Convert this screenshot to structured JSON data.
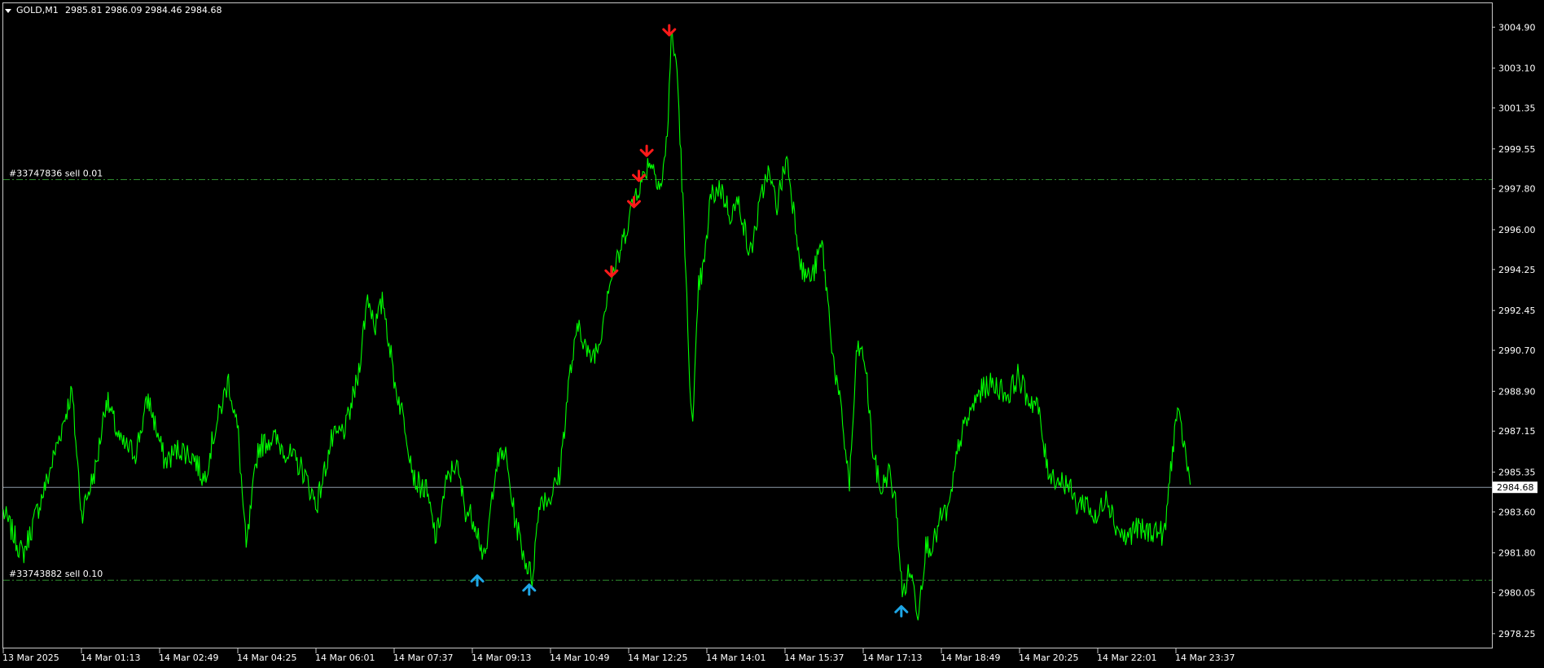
{
  "chart_header": {
    "symbol": "GOLD,M1",
    "ohlc": "2985.81 2986.09 2984.46 2984.68"
  },
  "colors": {
    "background": "#000000",
    "frame": "#c8c8c8",
    "price_line": "#00ff00",
    "current_price_line": "#8c9aa8",
    "order_line": "#2e8b2e",
    "sell_arrow": "#ff1a1a",
    "buy_arrow": "#1ea6e6",
    "text": "#ffffff"
  },
  "chart_data": {
    "type": "line",
    "symbol": "GOLD",
    "timeframe": "M1",
    "x_ticks": [
      "13 Mar 2025",
      "14 Mar 01:13",
      "14 Mar 02:49",
      "14 Mar 04:25",
      "14 Mar 06:01",
      "14 Mar 07:37",
      "14 Mar 09:13",
      "14 Mar 10:49",
      "14 Mar 12:25",
      "14 Mar 14:01",
      "14 Mar 15:37",
      "14 Mar 17:13",
      "14 Mar 18:49",
      "14 Mar 20:25",
      "14 Mar 22:01",
      "14 Mar 23:37"
    ],
    "y_ticks": [
      "3004.90",
      "3003.10",
      "3001.35",
      "2999.55",
      "2997.80",
      "2996.00",
      "2994.25",
      "2992.45",
      "2990.70",
      "2988.90",
      "2987.15",
      "2985.35",
      "2983.60",
      "2981.80",
      "2980.05",
      "2978.25"
    ],
    "ylim": [
      2977.6,
      3005.95
    ],
    "x_index_range": [
      0,
      1520
    ],
    "current_price": "2984.68",
    "series": [
      {
        "points": [
          [
            0,
            2983.6
          ],
          [
            20,
            2981.7
          ],
          [
            45,
            2985.0
          ],
          [
            70,
            2988.9
          ],
          [
            80,
            2983.5
          ],
          [
            95,
            2985.6
          ],
          [
            105,
            2988.6
          ],
          [
            120,
            2986.6
          ],
          [
            135,
            2986.2
          ],
          [
            148,
            2988.6
          ],
          [
            165,
            2985.8
          ],
          [
            180,
            2986.4
          ],
          [
            195,
            2986.0
          ],
          [
            205,
            2985.0
          ],
          [
            215,
            2987.0
          ],
          [
            230,
            2989.4
          ],
          [
            240,
            2987.0
          ],
          [
            248,
            2981.9
          ],
          [
            260,
            2986.4
          ],
          [
            275,
            2986.9
          ],
          [
            290,
            2986.2
          ],
          [
            305,
            2985.5
          ],
          [
            320,
            2983.9
          ],
          [
            335,
            2986.7
          ],
          [
            350,
            2987.3
          ],
          [
            362,
            2989.5
          ],
          [
            372,
            2993.1
          ],
          [
            380,
            2991.8
          ],
          [
            388,
            2992.9
          ],
          [
            400,
            2989.2
          ],
          [
            410,
            2987.5
          ],
          [
            420,
            2985.0
          ],
          [
            432,
            2984.5
          ],
          [
            442,
            2982.4
          ],
          [
            452,
            2984.8
          ],
          [
            462,
            2985.8
          ],
          [
            472,
            2983.7
          ],
          [
            482,
            2983.2
          ],
          [
            492,
            2981.3
          ],
          [
            502,
            2985.5
          ],
          [
            512,
            2986.3
          ],
          [
            522,
            2983.4
          ],
          [
            532,
            2981.6
          ],
          [
            540,
            2980.7
          ],
          [
            548,
            2984.2
          ],
          [
            558,
            2984.2
          ],
          [
            568,
            2985.2
          ],
          [
            578,
            2989.5
          ],
          [
            588,
            2991.9
          ],
          [
            598,
            2990.3
          ],
          [
            608,
            2990.9
          ],
          [
            618,
            2993.6
          ],
          [
            628,
            2994.7
          ],
          [
            638,
            2996.4
          ],
          [
            646,
            2997.7
          ],
          [
            652,
            2998.1
          ],
          [
            660,
            2999.1
          ],
          [
            668,
            2998.3
          ],
          [
            672,
            2997.9
          ],
          [
            678,
            3000.1
          ],
          [
            682,
            3004.5
          ],
          [
            688,
            3003.1
          ],
          [
            694,
            2997.2
          ],
          [
            700,
            2990.5
          ],
          [
            704,
            2987.2
          ],
          [
            710,
            2993.5
          ],
          [
            716,
            2994.5
          ],
          [
            722,
            2997.4
          ],
          [
            732,
            2997.9
          ],
          [
            742,
            2996.7
          ],
          [
            752,
            2997.2
          ],
          [
            762,
            2994.8
          ],
          [
            770,
            2996.5
          ],
          [
            780,
            2998.6
          ],
          [
            790,
            2997.1
          ],
          [
            800,
            2999.2
          ],
          [
            808,
            2996.6
          ],
          [
            816,
            2994.1
          ],
          [
            826,
            2993.9
          ],
          [
            836,
            2995.4
          ],
          [
            842,
            2992.8
          ],
          [
            848,
            2990.2
          ],
          [
            856,
            2987.8
          ],
          [
            864,
            2984.8
          ],
          [
            872,
            2990.9
          ],
          [
            880,
            2990.2
          ],
          [
            888,
            2986.2
          ],
          [
            896,
            2984.5
          ],
          [
            904,
            2985.4
          ],
          [
            912,
            2983.8
          ],
          [
            918,
            2979.9
          ],
          [
            926,
            2981.1
          ],
          [
            934,
            2979.2
          ],
          [
            942,
            2982.1
          ],
          [
            950,
            2982.2
          ],
          [
            958,
            2983.4
          ],
          [
            966,
            2983.7
          ],
          [
            976,
            2986.7
          ],
          [
            986,
            2987.8
          ],
          [
            996,
            2988.8
          ],
          [
            1006,
            2989.2
          ],
          [
            1016,
            2989.1
          ],
          [
            1026,
            2988.7
          ],
          [
            1036,
            2989.6
          ],
          [
            1046,
            2988.6
          ],
          [
            1056,
            2988.3
          ],
          [
            1066,
            2985.5
          ],
          [
            1076,
            2985.0
          ],
          [
            1086,
            2984.9
          ],
          [
            1096,
            2983.9
          ],
          [
            1106,
            2984.1
          ],
          [
            1116,
            2983.1
          ],
          [
            1126,
            2984.5
          ],
          [
            1136,
            2983.0
          ],
          [
            1146,
            2982.4
          ],
          [
            1156,
            2982.9
          ],
          [
            1166,
            2982.7
          ],
          [
            1176,
            2982.8
          ],
          [
            1186,
            2982.6
          ],
          [
            1192,
            2985.5
          ],
          [
            1198,
            2987.9
          ],
          [
            1204,
            2987.0
          ],
          [
            1212,
            2984.8
          ]
        ]
      }
    ],
    "order_lines": [
      {
        "label": "#33747836 sell 0.01",
        "price": 2998.2
      },
      {
        "label": "#33743882 sell 0.10",
        "price": 2980.6
      }
    ],
    "signals": [
      {
        "type": "sell",
        "x": 621,
        "price": 2993.95
      },
      {
        "type": "sell",
        "x": 644,
        "price": 2997.0
      },
      {
        "type": "sell",
        "x": 649,
        "price": 2998.15
      },
      {
        "type": "sell",
        "x": 657,
        "price": 2999.25
      },
      {
        "type": "sell",
        "x": 680,
        "price": 3004.55
      },
      {
        "type": "buy",
        "x": 484,
        "price": 2980.8
      },
      {
        "type": "buy",
        "x": 537,
        "price": 2980.4
      },
      {
        "type": "buy",
        "x": 917,
        "price": 2979.45
      }
    ]
  }
}
